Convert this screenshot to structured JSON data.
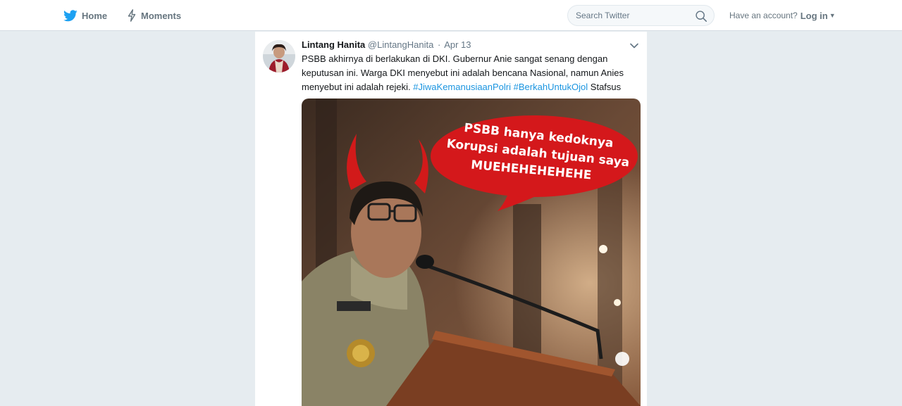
{
  "nav": {
    "home_label": "Home",
    "moments_label": "Moments"
  },
  "search": {
    "placeholder": "Search Twitter"
  },
  "account": {
    "prompt": "Have an account?",
    "login_label": "Log in"
  },
  "tweet": {
    "fullname": "Lintang Hanita",
    "handle": "@LintangHanita",
    "date": "Apr 13",
    "text_main": "PSBB akhirnya di berlakukan di DKI. Gubernur Anie sangat senang dengan keputusan ini. Warga DKI menyebut ini adalah bencana Nasional, namun Anies menyebut ini adalah rejeki.",
    "hashtags": [
      "#JiwaKemanusiaanPolri",
      "#BerkahUntukOjol"
    ],
    "text_tail": "Stafsus",
    "image_caption_lines": [
      "PSBB hanya kedoknya",
      "Korupsi adalah tujuan saya",
      "MUEHEHEHEHEHE"
    ]
  },
  "colors": {
    "twitter_blue": "#1da1f2",
    "link_blue": "#1b95e0",
    "bubble_red": "#d4181b",
    "background": "#e6ecf0"
  },
  "icons": {
    "home": "twitter-bird-icon",
    "moments": "lightning-icon",
    "search": "search-icon",
    "menu": "chevron-down-icon"
  }
}
